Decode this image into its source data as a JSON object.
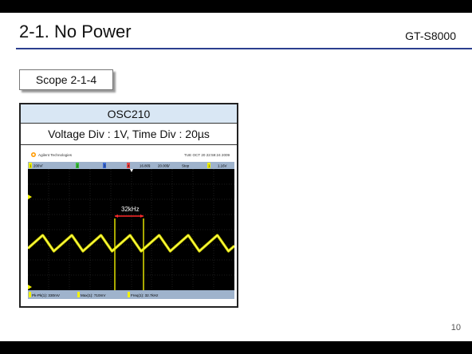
{
  "slide": {
    "title": "2-1. No Power",
    "model": "GT-S8000",
    "scope_label": "Scope 2-1-4",
    "page_number": "10"
  },
  "panel": {
    "heading": "OSC210",
    "settings": "Voltage Div : 1V, Time Div : 20µs"
  },
  "scope": {
    "brand": "Agilent Technologies",
    "timestamp": "TUE OCT 20 22:59:24 2009",
    "top_bar": {
      "ch1": "1",
      "ch1_scale": "200V/",
      "ch2": "2",
      "ch3": "3",
      "ch4": "4",
      "timebase_pos": "16.80§",
      "timebase": "20.00§/",
      "mode": "Stop",
      "trig_ch": "1",
      "trig_level": "1.16V"
    },
    "annotation": "32kHz",
    "measurements": {
      "pk_pk": "Pk-Pk(1): 330mV",
      "max": "Max(1): 710mV",
      "freq": "Freq(1): 32.7kHz"
    },
    "colors": {
      "trace": "#f2f200",
      "screen": "#000000",
      "grid": "#3a3a3a",
      "bar": "#9fb3cc",
      "marker": "#ff2a2a"
    }
  }
}
